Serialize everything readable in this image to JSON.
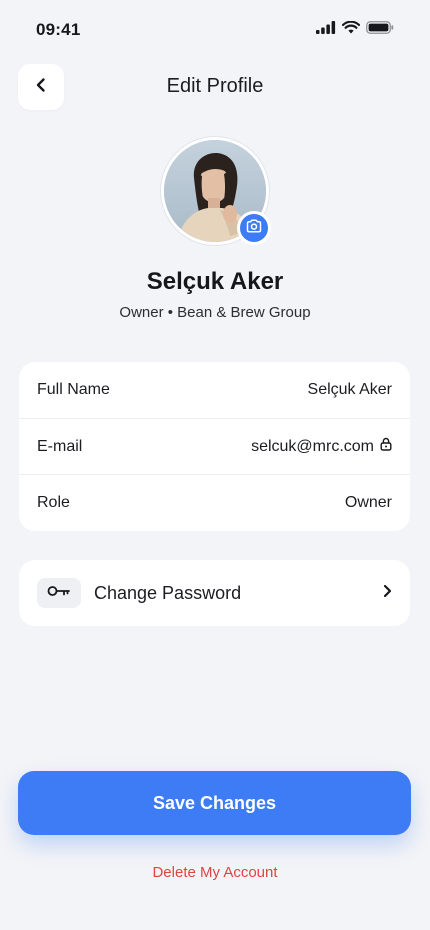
{
  "status_bar": {
    "time": "09:41"
  },
  "header": {
    "title": "Edit Profile",
    "back_icon": "chevron-left-icon"
  },
  "profile": {
    "name": "Selçuk Aker",
    "subtitle": "Owner • Bean & Brew Group",
    "camera_icon": "camera-icon"
  },
  "info": {
    "rows": [
      {
        "label": "Full Name",
        "value": "Selçuk Aker",
        "locked": false
      },
      {
        "label": "E-mail",
        "value": "selcuk@mrc.com",
        "locked": true
      },
      {
        "label": "Role",
        "value": "Owner",
        "locked": false
      }
    ]
  },
  "security": {
    "change_password_label": "Change Password",
    "key_icon": "key-icon",
    "chevron_icon": "chevron-right-icon"
  },
  "actions": {
    "save_label": "Save Changes",
    "delete_label": "Delete My Account"
  },
  "colors": {
    "accent": "#3d7cf5",
    "danger": "#e0443e",
    "background": "#f3f4f7"
  }
}
